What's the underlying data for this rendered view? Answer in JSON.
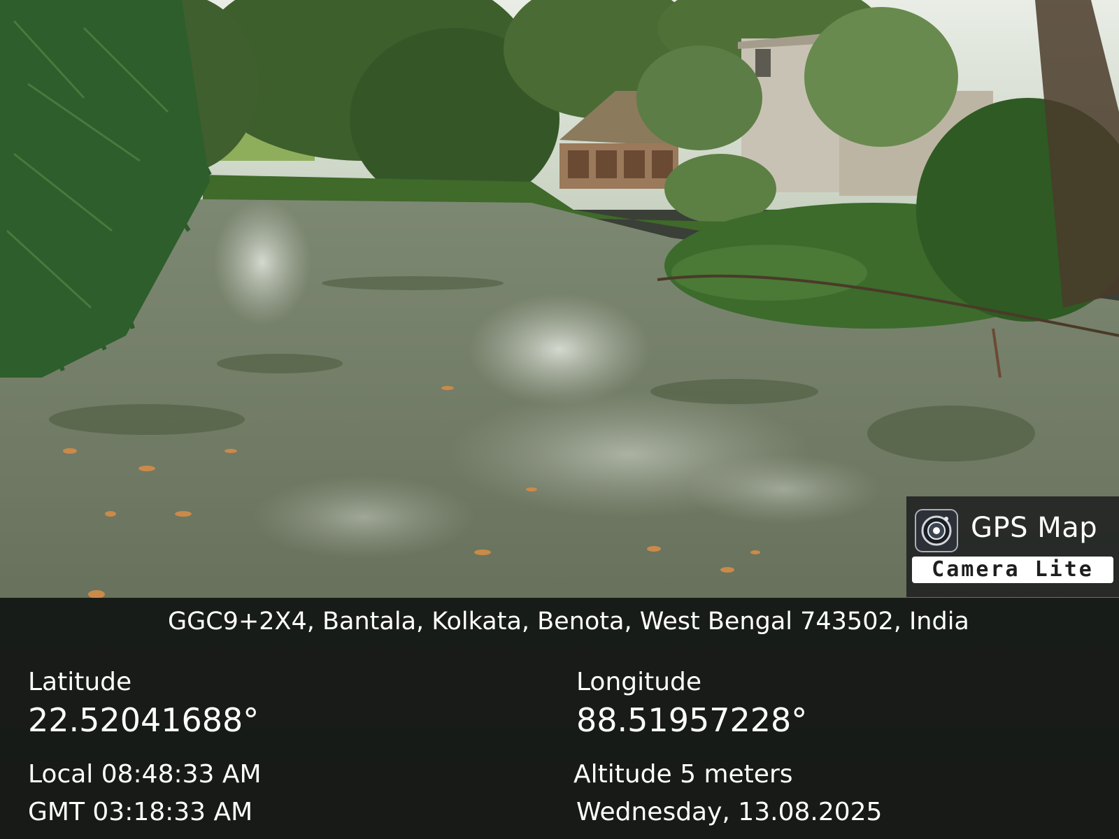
{
  "watermark": {
    "app_name": "GPS Map",
    "app_subtitle": "Camera Lite",
    "icon": "camera-lens-icon"
  },
  "location": {
    "address": "GGC9+2X4, Bantala, Kolkata, Benota, West Bengal 743502, India",
    "latitude_label": "Latitude",
    "latitude_value": "22.52041688°",
    "longitude_label": "Longitude",
    "longitude_value": "88.51957228°",
    "local_time": "Local 08:48:33 AM",
    "gmt_time": "GMT 03:18:33 AM",
    "altitude": "Altitude 5 meters",
    "date": "Wednesday, 13.08.2025"
  },
  "colors": {
    "panel_background": "#0c0e0d",
    "text": "#ffffff",
    "pond_water": "#6f7a63",
    "foliage": "#2f5a26"
  }
}
